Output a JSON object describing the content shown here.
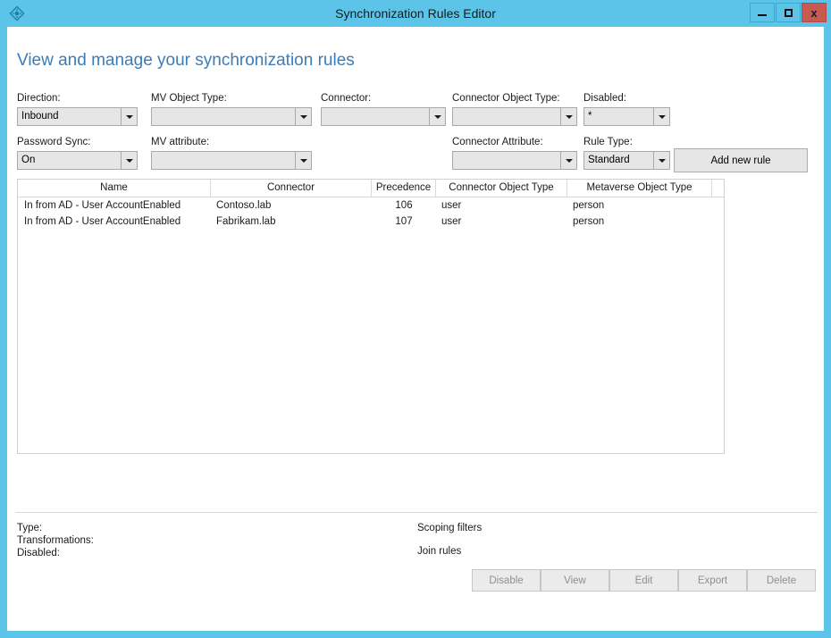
{
  "window": {
    "title": "Synchronization Rules Editor",
    "app_icon": "sync-diamond-icon",
    "controls": {
      "minimize": "minimize-icon",
      "maximize": "maximize-icon",
      "close": "x"
    },
    "accent_color": "#5bc4e8",
    "close_color": "#c75b52"
  },
  "page": {
    "heading": "View and manage your synchronization rules",
    "heading_color": "#3b7cb8"
  },
  "filters": {
    "direction": {
      "label": "Direction:",
      "value": "Inbound"
    },
    "mv_object_type": {
      "label": "MV Object Type:",
      "value": ""
    },
    "connector": {
      "label": "Connector:",
      "value": ""
    },
    "connector_object_type": {
      "label": "Connector Object Type:",
      "value": ""
    },
    "disabled": {
      "label": "Disabled:",
      "value": "*"
    },
    "password_sync": {
      "label": "Password Sync:",
      "value": "On"
    },
    "mv_attribute": {
      "label": "MV attribute:",
      "value": ""
    },
    "connector_attribute": {
      "label": "Connector Attribute:",
      "value": ""
    },
    "rule_type": {
      "label": "Rule Type:",
      "value": "Standard"
    }
  },
  "toolbar": {
    "add_new_rule": "Add new rule"
  },
  "grid": {
    "columns": [
      "Name",
      "Connector",
      "Precedence",
      "Connector Object Type",
      "Metaverse Object Type"
    ],
    "rows": [
      {
        "name": "In from AD - User AccountEnabled",
        "connector": "Contoso.lab",
        "precedence": "106",
        "connector_object_type": "user",
        "metaverse_object_type": "person"
      },
      {
        "name": "In from AD - User AccountEnabled",
        "connector": "Fabrikam.lab",
        "precedence": "107",
        "connector_object_type": "user",
        "metaverse_object_type": "person"
      }
    ]
  },
  "details": {
    "type_label": "Type:",
    "transformations_label": "Transformations:",
    "disabled_label": "Disabled:",
    "scoping_filters_label": "Scoping filters",
    "join_rules_label": "Join rules"
  },
  "actions": {
    "disable": "Disable",
    "view": "View",
    "edit": "Edit",
    "export": "Export",
    "delete": "Delete"
  }
}
